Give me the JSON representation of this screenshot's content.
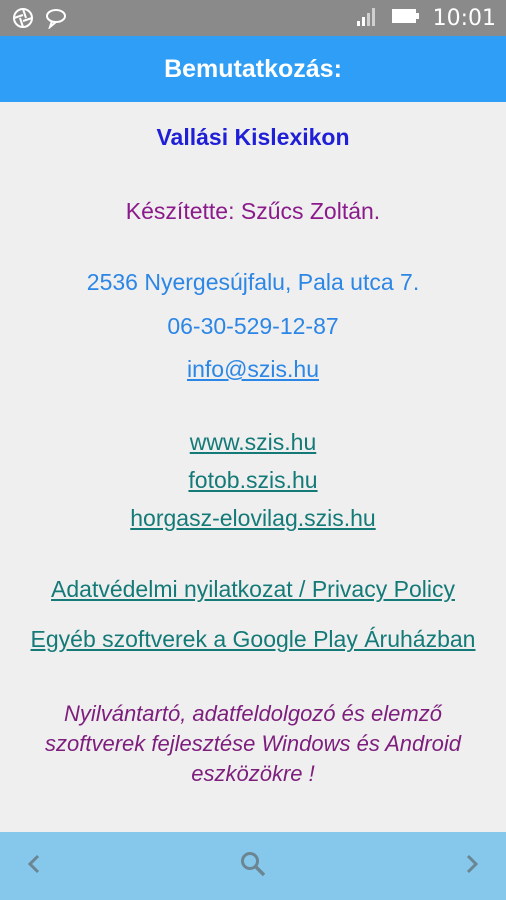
{
  "status_bar": {
    "time": "10:01",
    "left_icons": [
      "camera-shutter-icon",
      "chat-bubble-icon"
    ],
    "right_icons": [
      "signal-icon",
      "battery-icon"
    ]
  },
  "header": {
    "title": "Bemutatkozás:"
  },
  "content": {
    "app_title": "Vallási Kislexikon",
    "author": "Készítette: Szűcs Zoltán.",
    "address": "2536 Nyergesújfalu, Pala utca 7.",
    "phone": "06-30-529-12-87",
    "email": "info@szis.hu",
    "websites": [
      "www.szis.hu",
      "fotob.szis.hu",
      "horgasz-elovilag.szis.hu"
    ],
    "privacy_link": "Adatvédelmi nyilatkozat / Privacy Policy",
    "store_link": "Egyéb szoftverek a Google Play Áruházban",
    "slogan": "Nyilvántartó, adatfeldolgozó és elemző szoftverek fejlesztése Windows és Android eszközökre !"
  },
  "bottom_bar": {
    "icons": [
      "chevron-left-icon",
      "search-icon",
      "chevron-right-icon"
    ]
  },
  "colors": {
    "header": "#2f9ef7",
    "bottom_bar": "#86c8ec",
    "app_title": "#1f1fd8",
    "author": "#8b1a8b",
    "contact": "#2b86e6",
    "link": "#147a78",
    "slogan": "#7d1e7d"
  }
}
